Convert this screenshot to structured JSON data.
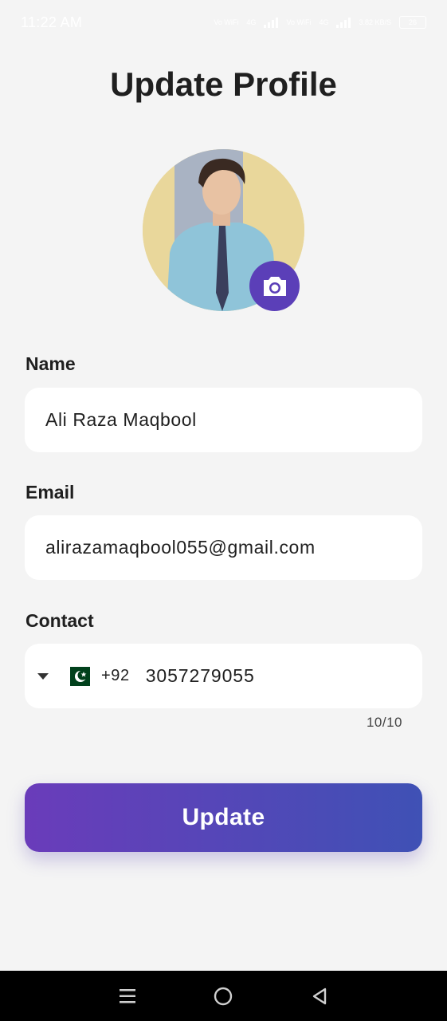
{
  "status_bar": {
    "time": "11:22 AM",
    "network_1": "Vo WiFi",
    "network_2": "4G",
    "network_3": "Vo WiFi",
    "network_4": "4G",
    "speed": "3.82 KB/S",
    "battery": "26"
  },
  "page": {
    "title": "Update Profile"
  },
  "avatar": {
    "icon": "camera-icon",
    "accent": "#5b3fb8"
  },
  "form": {
    "name_label": "Name",
    "name_value": "Ali Raza Maqbool",
    "email_label": "Email",
    "email_value": "alirazamaqbool055@gmail.com",
    "contact_label": "Contact",
    "dial_code": "+92",
    "phone_value": "3057279055",
    "phone_counter": "10/10",
    "country_flag": "pakistan-flag"
  },
  "actions": {
    "update_label": "Update"
  },
  "colors": {
    "background": "#f4f4f4",
    "gradient_start": "#6a3cba",
    "gradient_end": "#3f51b5"
  },
  "nav": {
    "menu_icon": "menu-icon",
    "home_icon": "home-circle-icon",
    "back_icon": "back-triangle-icon"
  }
}
